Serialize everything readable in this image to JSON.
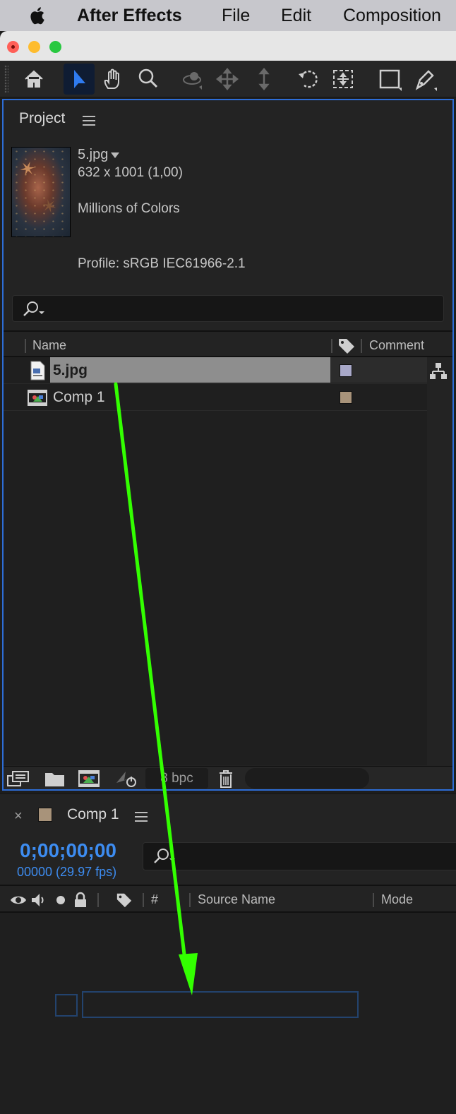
{
  "menubar": {
    "app_name": "After Effects",
    "items": [
      "File",
      "Edit",
      "Composition"
    ]
  },
  "toolbar": {
    "tools": [
      "home-icon",
      "selection-tool-icon",
      "hand-tool-icon",
      "zoom-tool-icon",
      "orbit-camera-icon",
      "pan-camera-icon",
      "dolly-camera-icon",
      "rotation-tool-icon",
      "pan-behind-icon",
      "rectangle-tool-icon",
      "pen-tool-icon"
    ],
    "active_tool": "selection-tool-icon"
  },
  "project": {
    "title": "Project",
    "selected_item": {
      "name": "5.jpg",
      "dimensions": "632 x 1001 (1,00)",
      "colors": "Millions of Colors",
      "profile": "Profile: sRGB IEC61966-2.1"
    },
    "columns": {
      "name": "Name",
      "comment": "Comment"
    },
    "items": [
      {
        "name": "5.jpg",
        "type": "footage",
        "label_color": "#a9a9c9",
        "selected": true
      },
      {
        "name": "Comp 1",
        "type": "composition",
        "label_color": "#a8937a",
        "selected": false
      }
    ],
    "footer": {
      "bpc": "8 bpc"
    }
  },
  "timeline": {
    "comp_name": "Comp 1",
    "timecode": "0;00;00;00",
    "frames": "00000 (29.97 fps)",
    "columns": {
      "hash": "#",
      "source_name": "Source Name",
      "mode": "Mode"
    }
  },
  "colors": {
    "accent": "#2d6dd6",
    "timecode": "#3d8cf0",
    "arrow": "#33ff00"
  }
}
